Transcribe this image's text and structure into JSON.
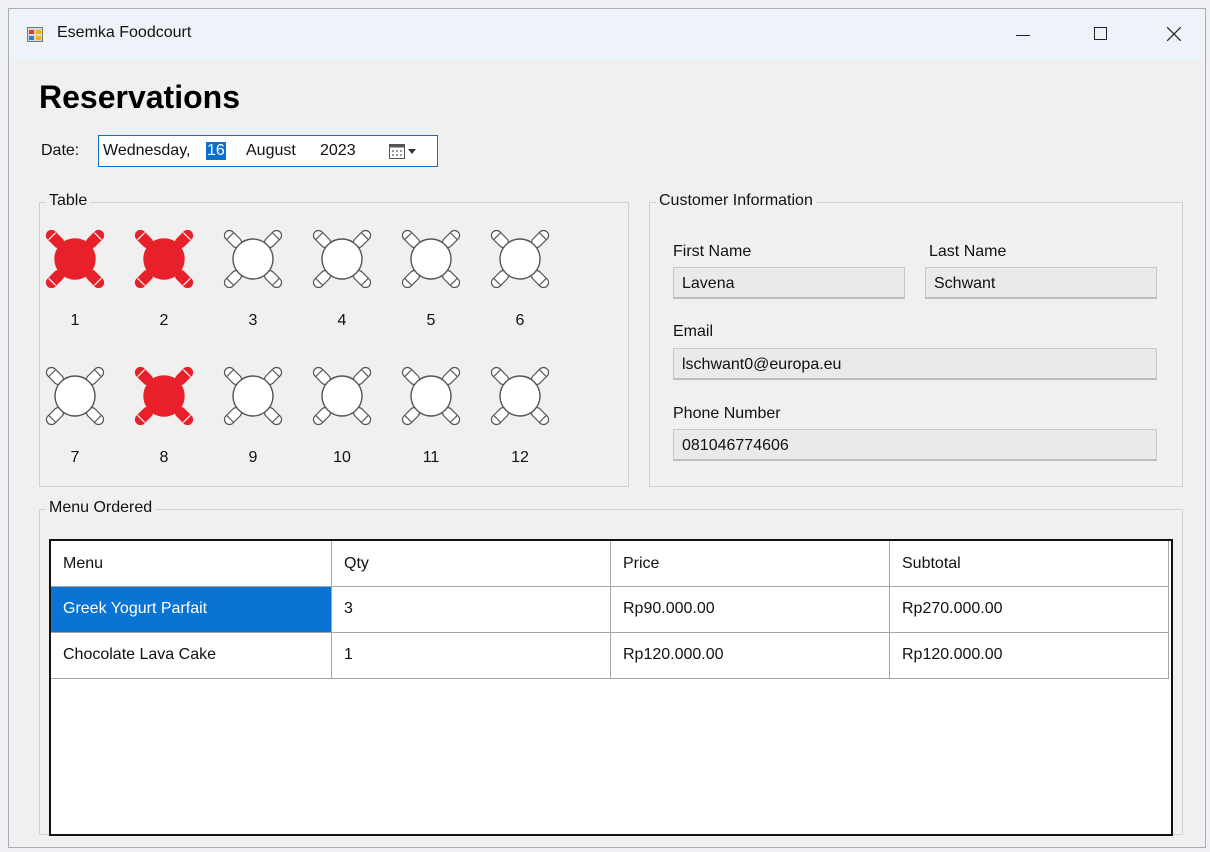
{
  "window": {
    "title": "Esemka Foodcourt"
  },
  "page": {
    "heading": "Reservations"
  },
  "date": {
    "label": "Date:",
    "weekday": "Wednesday,",
    "day": "16",
    "month": "August",
    "year": "2023"
  },
  "tables_group": {
    "title": "Table",
    "tables": [
      {
        "number": "1",
        "reserved": true
      },
      {
        "number": "2",
        "reserved": true
      },
      {
        "number": "3",
        "reserved": false
      },
      {
        "number": "4",
        "reserved": false
      },
      {
        "number": "5",
        "reserved": false
      },
      {
        "number": "6",
        "reserved": false
      },
      {
        "number": "7",
        "reserved": false
      },
      {
        "number": "8",
        "reserved": true
      },
      {
        "number": "9",
        "reserved": false
      },
      {
        "number": "10",
        "reserved": false
      },
      {
        "number": "11",
        "reserved": false
      },
      {
        "number": "12",
        "reserved": false
      }
    ]
  },
  "customer": {
    "title": "Customer Information",
    "first_name_label": "First Name",
    "first_name": "Lavena",
    "last_name_label": "Last Name",
    "last_name": "Schwant",
    "email_label": "Email",
    "email": "lschwant0@europa.eu",
    "phone_label": "Phone Number",
    "phone": "081046774606"
  },
  "menu_ordered": {
    "title": "Menu Ordered",
    "columns": [
      "Menu",
      "Qty",
      "Price",
      "Subtotal"
    ],
    "rows": [
      [
        "Greek Yogurt Parfait",
        "3",
        "Rp90.000.00",
        "Rp270.000.00"
      ],
      [
        "Chocolate Lava Cake",
        "1",
        "Rp120.000.00",
        "Rp120.000.00"
      ]
    ],
    "selected_row": 0
  },
  "colors": {
    "reserved": "#e8202a",
    "available": "#555555",
    "selection": "#0a74d4",
    "accent": "#1170cf"
  },
  "icons": [
    "app-icon",
    "minimize-icon",
    "maximize-icon",
    "close-icon",
    "calendar-dropdown-icon",
    "table-icon"
  ]
}
